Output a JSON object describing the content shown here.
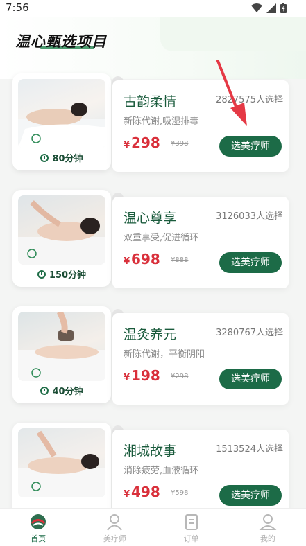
{
  "status": {
    "time": "7:56"
  },
  "header": {
    "title": "温心甄选项目"
  },
  "services": [
    {
      "name": "古韵柔情",
      "count": "2827575人选择",
      "desc": "新陈代谢,吸湿排毒",
      "price": "298",
      "orig": "¥398",
      "duration": "80分钟",
      "button": "选美疗师"
    },
    {
      "name": "温心尊享",
      "count": "3126033人选择",
      "desc": "双重享受,促进循环",
      "price": "698",
      "orig": "¥888",
      "duration": "150分钟",
      "button": "选美疗师"
    },
    {
      "name": "温灸养元",
      "count": "3280767人选择",
      "desc": "新陈代谢，平衡阴阳",
      "price": "198",
      "orig": "¥298",
      "duration": "40分钟",
      "button": "选美疗师"
    },
    {
      "name": "湘城故事",
      "count": "1513524人选择",
      "desc": "消除疲劳,血液循环",
      "price": "498",
      "orig": "¥598",
      "duration": "",
      "button": "选美疗师"
    }
  ],
  "currency": "¥",
  "nav": [
    {
      "label": "首页",
      "icon": "home-icon"
    },
    {
      "label": "美疗师",
      "icon": "therapist-icon"
    },
    {
      "label": "订单",
      "icon": "order-icon"
    },
    {
      "label": "我的",
      "icon": "profile-icon"
    }
  ],
  "colors": {
    "brand": "#1c6b47",
    "price": "#d9303b",
    "arrow": "#e53945"
  }
}
